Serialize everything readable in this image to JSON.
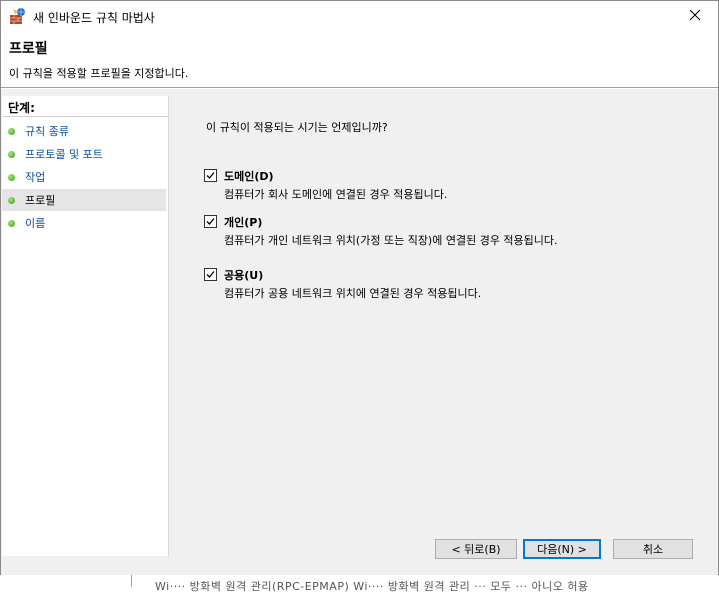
{
  "window": {
    "title": "새 인바운드 규칙 마법사",
    "page_title": "프로필",
    "page_subtitle": "이 규칙을 적용할 프로필을 지정합니다."
  },
  "sidebar": {
    "steps_label": "단계:",
    "items": [
      {
        "label": "규칙 종류",
        "state": "link"
      },
      {
        "label": "프로토콜 및 포트",
        "state": "link"
      },
      {
        "label": "작업",
        "state": "link"
      },
      {
        "label": "프로필",
        "state": "current"
      },
      {
        "label": "이름",
        "state": "link"
      }
    ]
  },
  "main": {
    "question": "이 규칙이 적용되는 시기는 언제입니까?",
    "options": [
      {
        "title": "도메인(D)",
        "desc": "컴퓨터가 회사 도메인에 연결된 경우 적용됩니다.",
        "checked": true
      },
      {
        "title": "개인(P)",
        "desc": "컴퓨터가 개인 네트워크 위치(가정 또는 직장)에 연결된 경우 적용됩니다.",
        "checked": true
      },
      {
        "title": "공용(U)",
        "desc": "컴퓨터가 공용 네트워크 위치에 연결된 경우 적용됩니다.",
        "checked": true
      }
    ]
  },
  "buttons": {
    "back": "< 뒤로(B)",
    "next": "다음(N) >",
    "cancel": "취소"
  },
  "background": {
    "text": "Wi···· 방화벽 원격 관리(RPC-EPMAP)   Wi···· 방화벽 원격 관리   ··· 모두   ··· 아니오   허용"
  },
  "colors": {
    "link": "#0a50a0",
    "active_step_bg": "#e5e5e5",
    "dialog_bg": "#f0f0f0",
    "default_button_border": "#0078d7"
  }
}
